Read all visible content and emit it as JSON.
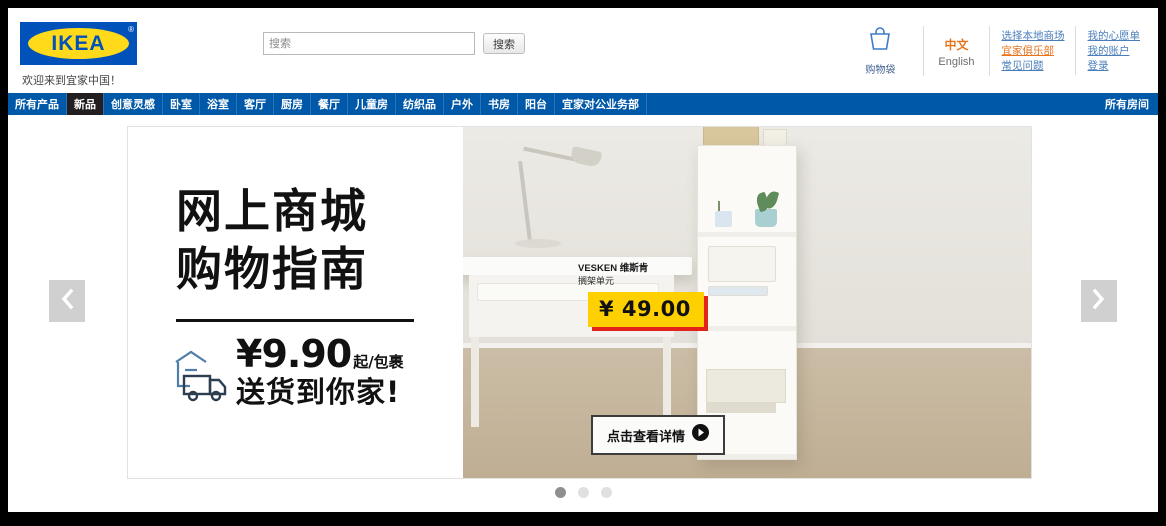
{
  "header": {
    "logo_text": "IKEA",
    "logo_reg": "®",
    "welcome": "欢迎来到宜家中国！",
    "search": {
      "placeholder": "搜索",
      "value": "",
      "button_label": "搜索"
    },
    "bag": {
      "icon": "shopping-bag-icon",
      "label": "购物袋"
    },
    "language": {
      "chinese": "中文",
      "english": "English"
    },
    "links_col1": [
      {
        "label": "选择本地商场",
        "accent": false
      },
      {
        "label": "宜家俱乐部",
        "accent": true
      },
      {
        "label": "常见问题",
        "accent": false
      }
    ],
    "links_col2": [
      {
        "label": "我的心愿单",
        "accent": false
      },
      {
        "label": "我的账户",
        "accent": false
      },
      {
        "label": "登录",
        "accent": false
      }
    ]
  },
  "nav": {
    "items": [
      {
        "label": "所有产品",
        "active": false
      },
      {
        "label": "新品",
        "active": true
      },
      {
        "label": "创意灵感",
        "active": false
      },
      {
        "label": "卧室",
        "active": false
      },
      {
        "label": "浴室",
        "active": false
      },
      {
        "label": "客厅",
        "active": false
      },
      {
        "label": "厨房",
        "active": false
      },
      {
        "label": "餐厅",
        "active": false
      },
      {
        "label": "儿童房",
        "active": false
      },
      {
        "label": "纺织品",
        "active": false
      },
      {
        "label": "户外",
        "active": false
      },
      {
        "label": "书房",
        "active": false
      },
      {
        "label": "阳台",
        "active": false
      },
      {
        "label": "宜家对公业务部",
        "active": false
      }
    ],
    "right_label": "所有房间"
  },
  "hero": {
    "heading_line1": "网上商城",
    "heading_line2": "购物指南",
    "price_amount": "¥9.90",
    "price_suffix": "起/包裹",
    "delivery_text": "送货到你家!",
    "truck_icon": "delivery-truck-icon",
    "product": {
      "name": "VESKEN 维斯肯",
      "subtitle": "搁架单元",
      "price": "¥ 49.00",
      "price_bg": "#ffd000",
      "price_shadow": "#e2231a"
    },
    "cta_label": "点击查看详情",
    "cta_icon": "play-arrow-icon",
    "prev_icon": "chevron-left-icon",
    "next_icon": "chevron-right-icon",
    "dots": [
      {
        "active": true
      },
      {
        "active": false
      },
      {
        "active": false
      }
    ]
  },
  "colors": {
    "brand_blue": "#0051ba",
    "brand_yellow": "#ffda1a",
    "nav_blue": "#0058a8",
    "link_blue": "#4a7ebb",
    "accent_orange": "#e8741e"
  }
}
